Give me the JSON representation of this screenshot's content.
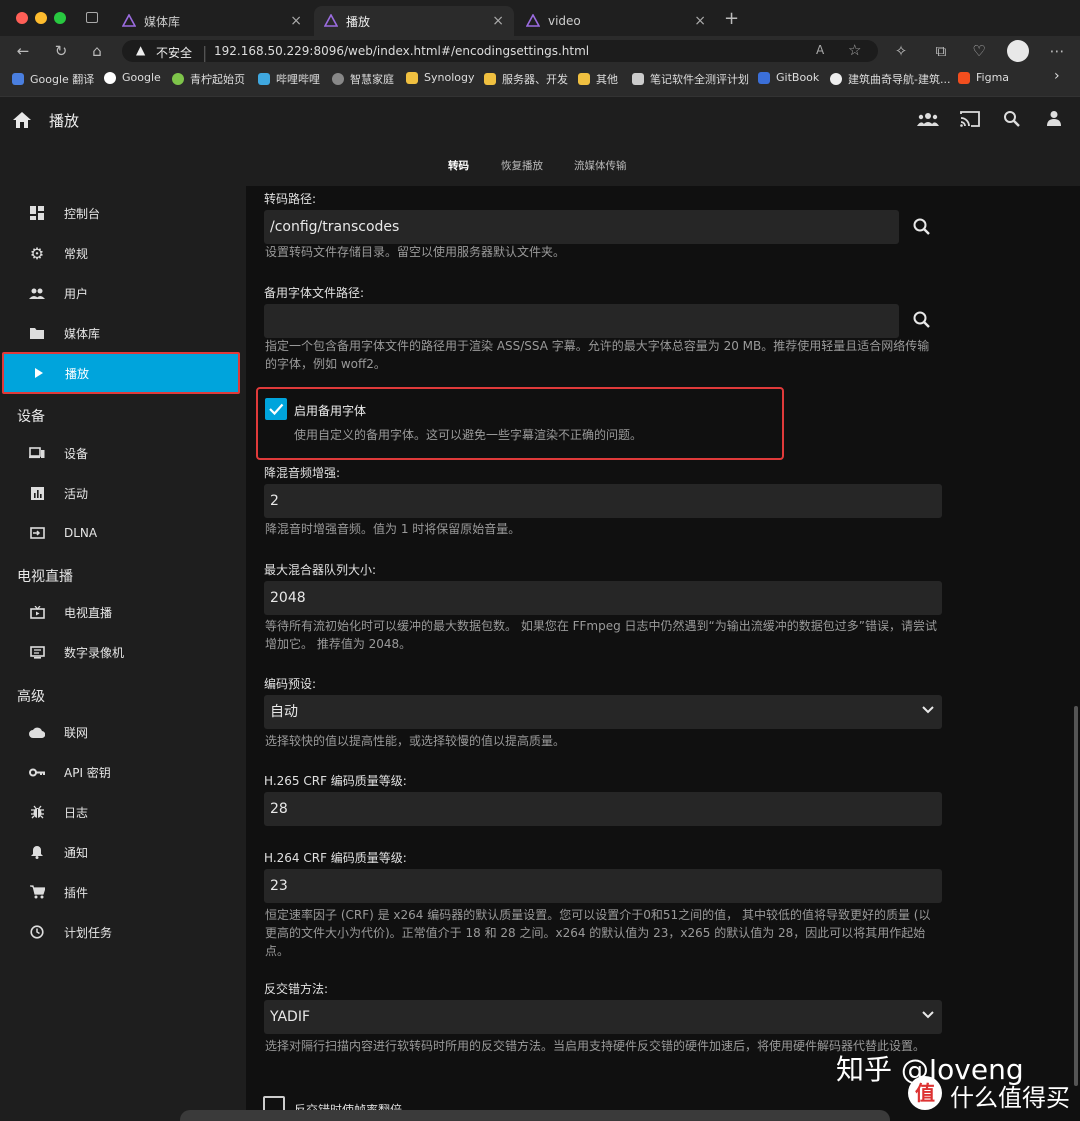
{
  "browser": {
    "tabs": [
      {
        "label": "媒体库",
        "close": "×"
      },
      {
        "label": "播放",
        "close": "×"
      },
      {
        "label": "video",
        "close": "×"
      }
    ],
    "new_tab": "+",
    "security": "不安全",
    "url": "192.168.50.229:8096/web/index.html#/encodingsettings.html",
    "bookmarks": [
      "Google 翻译",
      "Google",
      "青柠起始页",
      "哔哩哔哩",
      "智慧家庭",
      "Synology",
      "服务器、开发",
      "其他",
      "笔记软件全测评计划",
      "GitBook",
      "建筑曲奇导航-建筑...",
      "Figma"
    ]
  },
  "header": {
    "title": "播放",
    "tabs": [
      "转码",
      "恢复播放",
      "流媒体传输"
    ]
  },
  "sidebar": {
    "items_top": [
      {
        "label": "控制台",
        "icon": "dashboard-icon"
      },
      {
        "label": "常规",
        "icon": "gear-icon"
      },
      {
        "label": "用户",
        "icon": "users-icon"
      },
      {
        "label": "媒体库",
        "icon": "folder-icon"
      },
      {
        "label": "播放",
        "icon": "play-icon"
      }
    ],
    "section_devices": "设备",
    "items_devices": [
      {
        "label": "设备",
        "icon": "devices-icon"
      },
      {
        "label": "活动",
        "icon": "activity-icon"
      },
      {
        "label": "DLNA",
        "icon": "dlna-icon"
      }
    ],
    "section_livetv": "电视直播",
    "items_livetv": [
      {
        "label": "电视直播",
        "icon": "tv-icon"
      },
      {
        "label": "数字录像机",
        "icon": "dvr-icon"
      }
    ],
    "section_advanced": "高级",
    "items_advanced": [
      {
        "label": "联网",
        "icon": "cloud-icon"
      },
      {
        "label": "API 密钥",
        "icon": "key-icon"
      },
      {
        "label": "日志",
        "icon": "bug-icon"
      },
      {
        "label": "通知",
        "icon": "bell-icon"
      },
      {
        "label": "插件",
        "icon": "cart-icon"
      },
      {
        "label": "计划任务",
        "icon": "clock-icon"
      }
    ]
  },
  "form": {
    "transcode_path": {
      "label": "转码路径:",
      "value": "/config/transcodes",
      "desc": "设置转码文件存储目录。留空以使用服务器默认文件夹。"
    },
    "fallback_font_path": {
      "label": "备用字体文件路径:",
      "value": "",
      "desc": "指定一个包含备用字体文件的路径用于渲染 ASS/SSA 字幕。允许的最大字体总容量为 20 MB。推荐使用轻量且适合网络传输的字体，例如 woff2。"
    },
    "enable_fallback_font": {
      "label": "启用备用字体",
      "desc": "使用自定义的备用字体。这可以避免一些字幕渲染不正确的问题。",
      "checked": true
    },
    "downmix_boost": {
      "label": "降混音频增强:",
      "value": "2",
      "desc": "降混音时增强音频。值为 1 时将保留原始音量。"
    },
    "max_muxing_queue": {
      "label": "最大混合器队列大小:",
      "value": "2048",
      "desc": "等待所有流初始化时可以缓冲的最大数据包数。 如果您在 FFmpeg 日志中仍然遇到“为输出流缓冲的数据包过多”错误，请尝试增加它。 推荐值为 2048。"
    },
    "encoder_preset": {
      "label": "编码预设:",
      "value": "自动",
      "desc": "选择较快的值以提高性能，或选择较慢的值以提高质量。"
    },
    "h265_crf": {
      "label": "H.265 CRF 编码质量等级:",
      "value": "28"
    },
    "h264_crf": {
      "label": "H.264 CRF 编码质量等级:",
      "value": "23",
      "desc": "恒定速率因子 (CRF) 是 x264 编码器的默认质量设置。您可以设置介于0和51之间的值， 其中较低的值将导致更好的质量 (以更高的文件大小为代价)。正常值介于 18 和 28 之间。x264 的默认值为 23，x265 的默认值为 28，因此可以将其用作起始点。"
    },
    "deinterlace": {
      "label": "反交错方法:",
      "value": "YADIF",
      "desc": "选择对隔行扫描内容进行软转码时所用的反交错方法。当启用支持硬件反交错的硬件加速后，将使用硬件解码器代替此设置。"
    },
    "double_rate": {
      "label": "反交错时使帧率翻倍"
    }
  },
  "watermark": {
    "text": "知乎 @Joveng",
    "badge": "值",
    "site": "什么值得买"
  },
  "colors": {
    "accent": "#00a4dc",
    "highlight": "#e03a3a",
    "bg": "#101010",
    "panel": "#1e1e1e",
    "input": "#262626"
  }
}
